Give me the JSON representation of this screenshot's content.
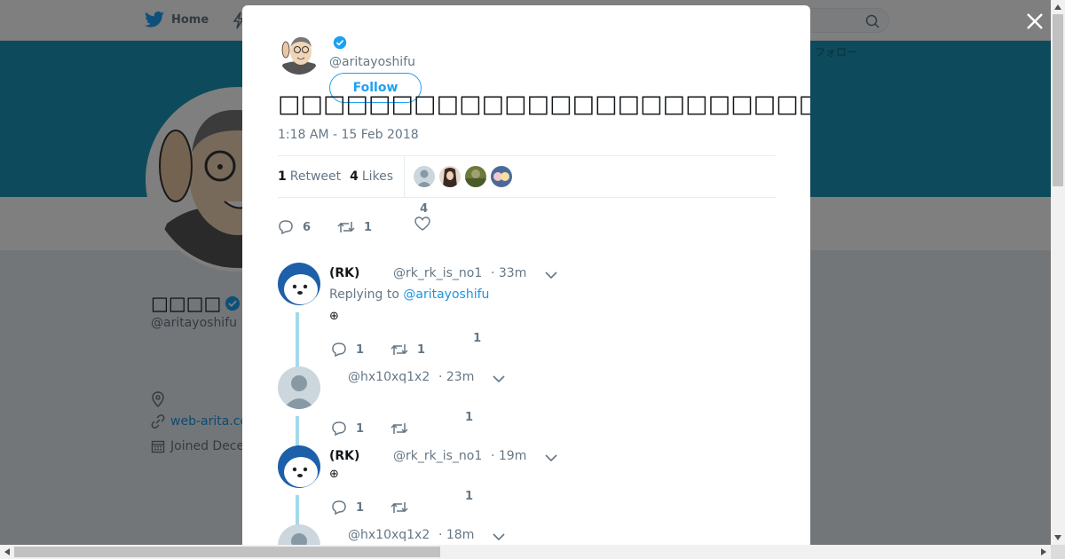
{
  "nav": {
    "home_label": "Home",
    "banner_text": "フォロー"
  },
  "profile": {
    "name": "□□□□",
    "handle": "@aritayoshifu",
    "website": "web-arita.co",
    "joined": "Joined Dece"
  },
  "tweet": {
    "author_handle": "@aritayoshifu",
    "follow_label": "Follow",
    "text": "□□□□□□□□□□□□□□□□□□□□□□□□□□□□□□□□□□□□□□□□□□□□□□□□□□□□□□□□□□□□□□□□□□□□□□□□  □□□□□□□□□□□□□□□□□□□□□□□□□□□□□□□□",
    "timestamp": "1:18 AM - 15 Feb 2018",
    "retweets_count": "1",
    "retweets_label": "Retweet",
    "likes_count": "4",
    "likes_label": "Likes",
    "actions": {
      "replies": "6",
      "retweets": "1",
      "likes": "4"
    }
  },
  "replies": [
    {
      "name": "(RK)",
      "handle": "@rk_rk_is_no1",
      "time": "· 33m",
      "replying_prefix": "Replying to",
      "replying_to": "@aritayoshifu",
      "text": "⊕",
      "replies": "1",
      "retweets": "1",
      "likes": "1"
    },
    {
      "name": "",
      "handle": "@hx10xq1x2",
      "time": "· 23m",
      "replies": "1",
      "retweets": "",
      "likes": "1"
    },
    {
      "name": "(RK)",
      "handle": "@rk_rk_is_no1",
      "time": "· 19m",
      "text": "⊕",
      "replies": "1",
      "retweets": "",
      "likes": "1"
    },
    {
      "name": "",
      "handle": "@hx10xq1x2",
      "time": "· 18m"
    }
  ],
  "colors": {
    "brand": "#1da1f2",
    "banner": "#1b95b6",
    "link": "#1b95e0",
    "thread": "#a4d9ec"
  }
}
